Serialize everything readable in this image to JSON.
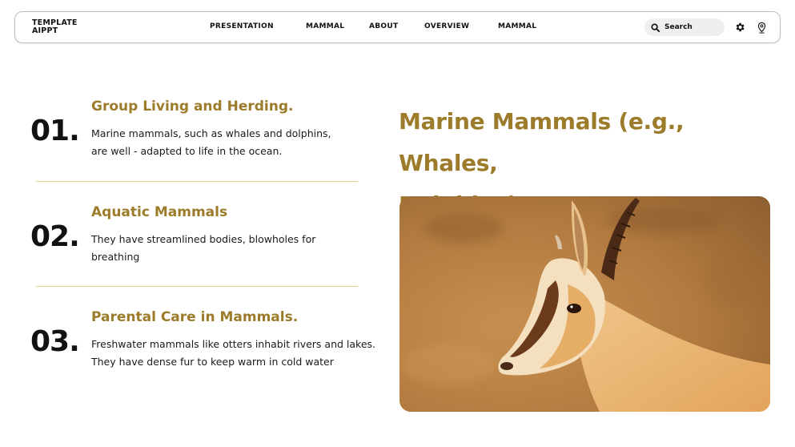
{
  "brand": {
    "logo_line1": "TEMPLATE",
    "logo_line2": "AIPPT"
  },
  "nav": {
    "items": [
      {
        "label": "PRESENTATION"
      },
      {
        "label": "MAMMAL"
      },
      {
        "label": "ABOUT"
      },
      {
        "label": "OVERVIEW"
      },
      {
        "label": "MAMMAL"
      }
    ],
    "search_placeholder": "Search",
    "icons": [
      "search-icon",
      "gear-icon",
      "location-pin-icon"
    ]
  },
  "content": {
    "items": [
      {
        "number": "01.",
        "title": "Group Living and Herding.",
        "text_line1": "Marine mammals, such as whales and dolphins,",
        "text_line2": "are well - adapted to life in the ocean."
      },
      {
        "number": "02.",
        "title": "Aquatic Mammals",
        "text_line1": "They have streamlined bodies, blowholes for",
        "text_line2": "breathing"
      },
      {
        "number": "03.",
        "title": "Parental Care in Mammals.",
        "text_line1": "Freshwater mammals like otters inhabit rivers and lakes.",
        "text_line2": "They have dense fur to keep warm in cold water"
      }
    ],
    "main_title_line1": "Marine Mammals (e.g., Whales,",
    "main_title_line2": "Dolphins)"
  },
  "colors": {
    "accent": "#9c7b2a",
    "divider": "#e8cf8a",
    "text": "#111111"
  }
}
